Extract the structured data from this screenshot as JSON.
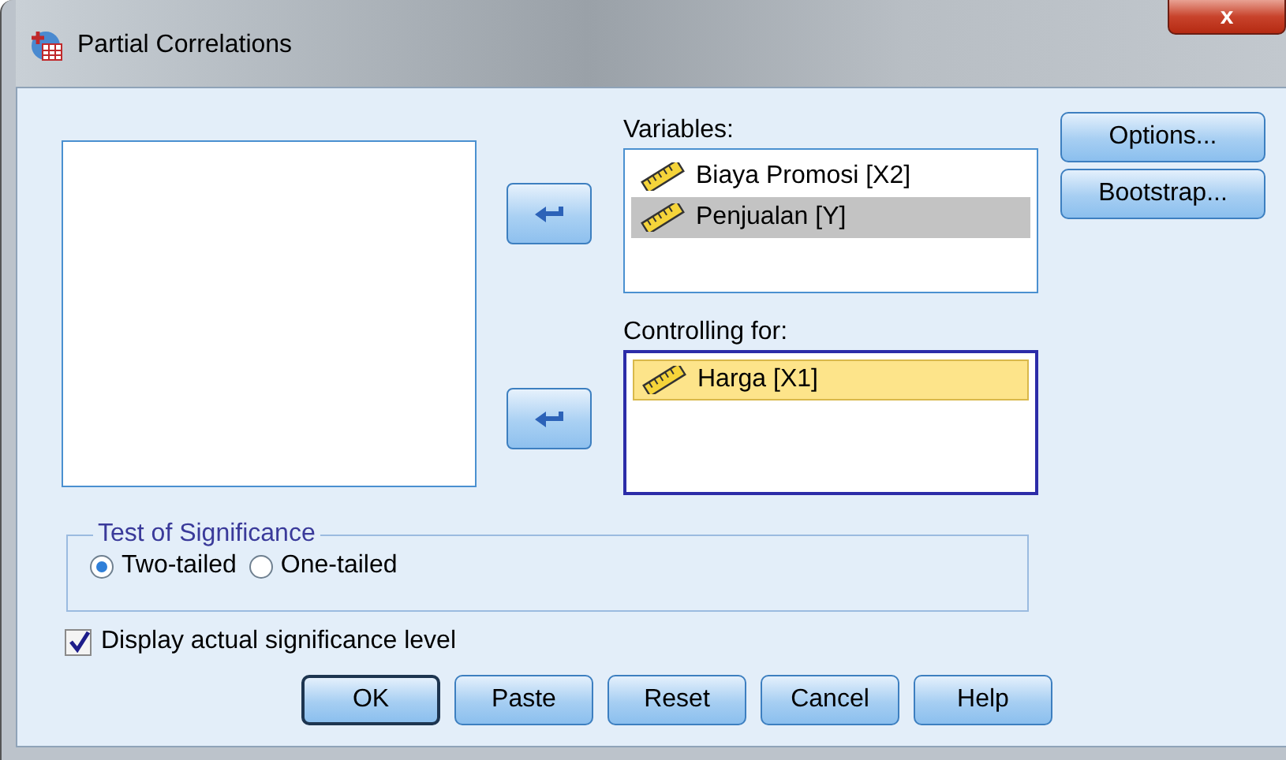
{
  "window": {
    "title": "Partial Correlations",
    "close": "x"
  },
  "variables": {
    "label": "Variables:",
    "items": [
      {
        "name": "Biaya Promosi [X2]",
        "selected": false
      },
      {
        "name": "Penjualan [Y]",
        "selected": true
      }
    ]
  },
  "controlling": {
    "label": "Controlling for:",
    "focused": true,
    "items": [
      {
        "name": "Harga [X1]",
        "selected": true
      }
    ]
  },
  "side_buttons": [
    "Options...",
    "Bootstrap..."
  ],
  "test_of_significance": {
    "title": "Test of Significance",
    "options": [
      {
        "label": "Two-tailed",
        "selected": true
      },
      {
        "label": "One-tailed",
        "selected": false
      }
    ]
  },
  "display_actual": {
    "label": "Display actual significance level",
    "checked": true
  },
  "buttons": [
    {
      "label": "OK",
      "default": true
    },
    {
      "label": "Paste",
      "default": false
    },
    {
      "label": "Reset",
      "default": false
    },
    {
      "label": "Cancel",
      "default": false
    },
    {
      "label": "Help",
      "default": false
    }
  ]
}
